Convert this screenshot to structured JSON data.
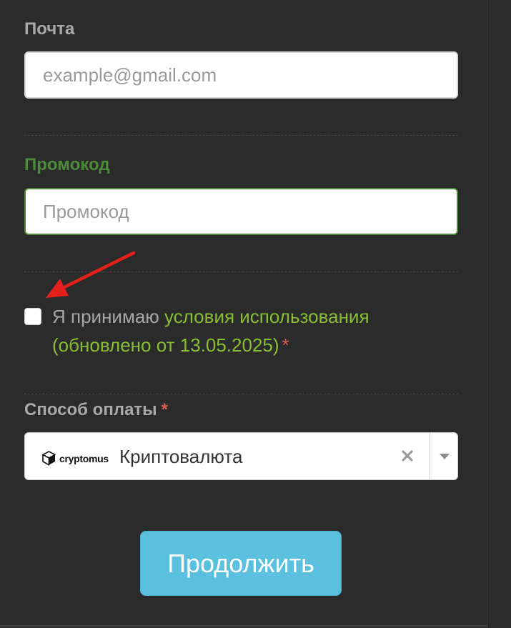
{
  "email": {
    "label": "Почта",
    "placeholder": "example@gmail.com",
    "value": ""
  },
  "promo": {
    "label": "Промокод",
    "placeholder": "Промокод",
    "value": ""
  },
  "terms": {
    "prefix": "Я принимаю ",
    "link_text": "условия использования (обновлено от 13.05.2025)",
    "required_mark": "*",
    "checked": false
  },
  "payment": {
    "label": "Способ оплаты",
    "required_mark": "*",
    "brand_name": "cryptomus",
    "brand_icon": "cube-logo-icon",
    "selected_value": "Криптовалюта",
    "clear_icon": "close-icon",
    "dropdown_icon": "caret-down-icon"
  },
  "submit_label": "Продолжить",
  "colors": {
    "background": "#2b2b2b",
    "promo_accent": "#4d8a3c",
    "link": "#88be34",
    "required": "#e0584f",
    "button": "#5bc0de",
    "annotation_arrow": "#e3211c"
  }
}
